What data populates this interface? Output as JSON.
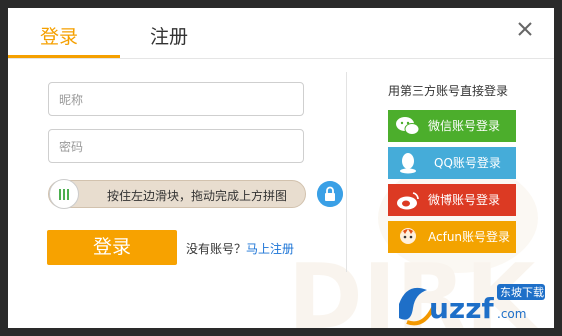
{
  "tabs": {
    "login": "登录",
    "register": "注册"
  },
  "form": {
    "nickname_placeholder": "昵称",
    "password_placeholder": "密码",
    "slider_text": "按住左边滑块，拖动完成上方拼图",
    "login_button": "登录",
    "no_account_text": "没有账号？",
    "register_link": "马上注册"
  },
  "third_party": {
    "title": "用第三方账号直接登录",
    "buttons": [
      {
        "label": "微信账号登录",
        "color": "#4cae2c",
        "icon": "wechat-icon"
      },
      {
        "label": "QQ账号登录",
        "color": "#45acd9",
        "icon": "qq-icon"
      },
      {
        "label": "微博账号登录",
        "color": "#dc3a23",
        "icon": "weibo-icon"
      },
      {
        "label": "Acfun账号登录",
        "color": "#f3a300",
        "icon": "acfun-icon"
      }
    ]
  },
  "colors": {
    "accent": "#f5a000",
    "link": "#1a73d6"
  },
  "watermark": {
    "text": "uzzf.com",
    "badge": "东坡下载"
  }
}
